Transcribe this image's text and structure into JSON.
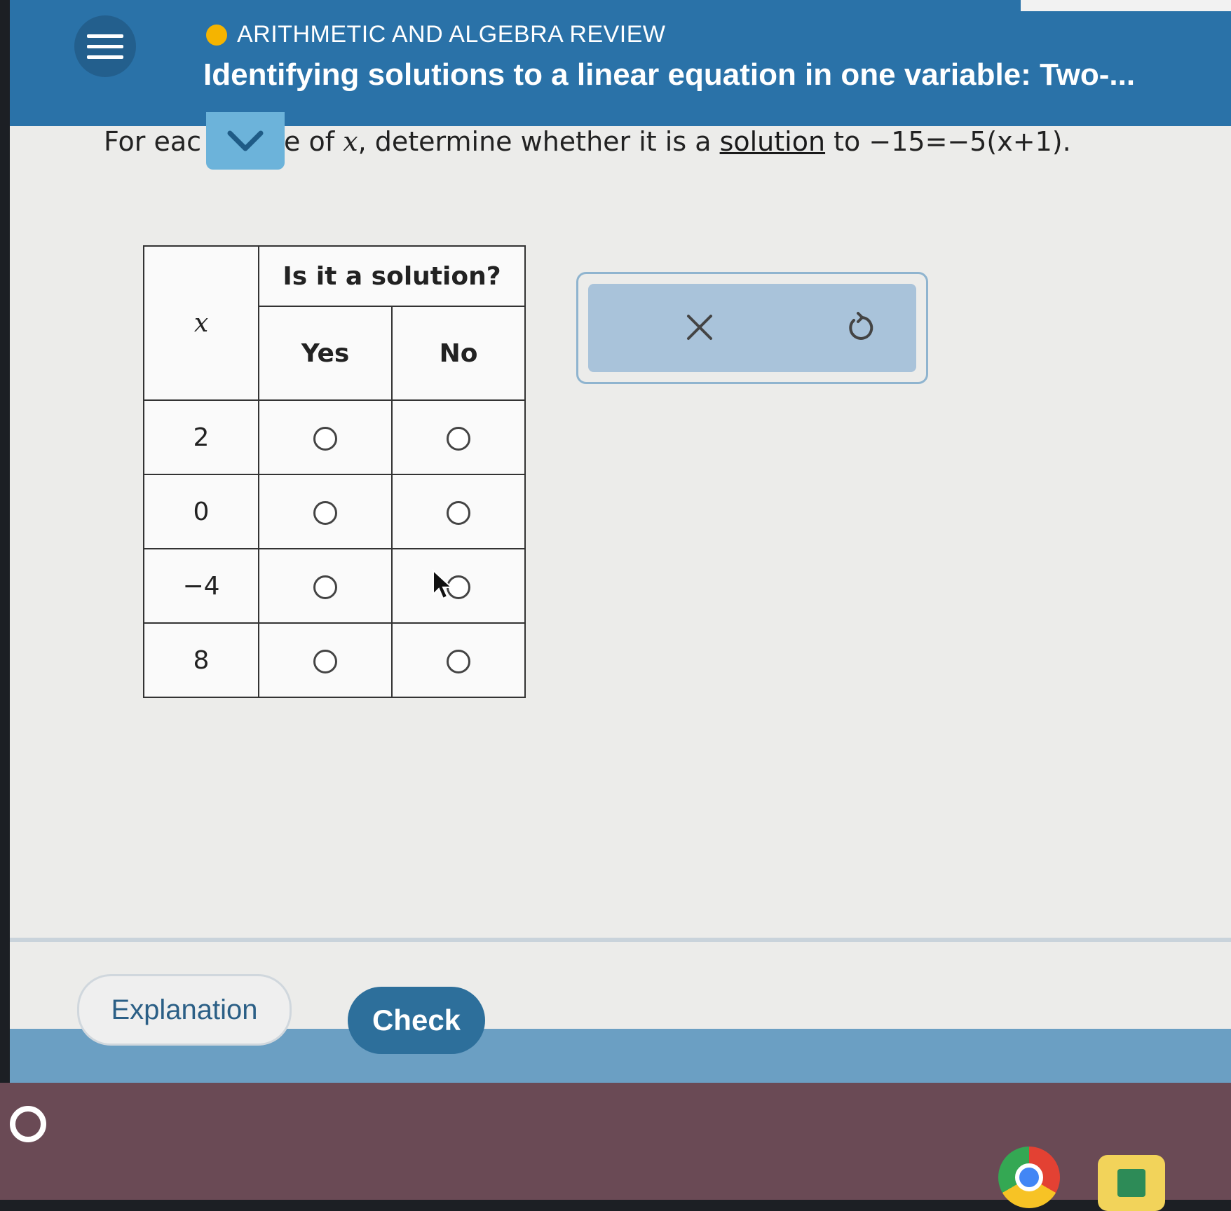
{
  "header": {
    "topic": "ARITHMETIC AND ALGEBRA REVIEW",
    "title": "Identifying solutions to a linear equation in one variable: Two-..."
  },
  "question": {
    "prefix": "For eac",
    "middle": "e of ",
    "variable": "x",
    "text": ", determine whether it is a ",
    "term": "solution",
    "to": " to ",
    "equation": "−15=−5(x+1)."
  },
  "table": {
    "header_x": "x",
    "header_group": "Is it a solution?",
    "col_yes": "Yes",
    "col_no": "No",
    "rows": [
      {
        "x": "2"
      },
      {
        "x": "0"
      },
      {
        "x": "−4"
      },
      {
        "x": "8"
      }
    ]
  },
  "tools": {
    "clear_icon": "close-icon",
    "undo_icon": "undo-icon"
  },
  "footer": {
    "explanation_label": "Explanation",
    "check_label": "Check"
  },
  "colors": {
    "header_bg": "#2a72a8",
    "accent_dot": "#f5b400",
    "check_button": "#2d6f9b"
  }
}
